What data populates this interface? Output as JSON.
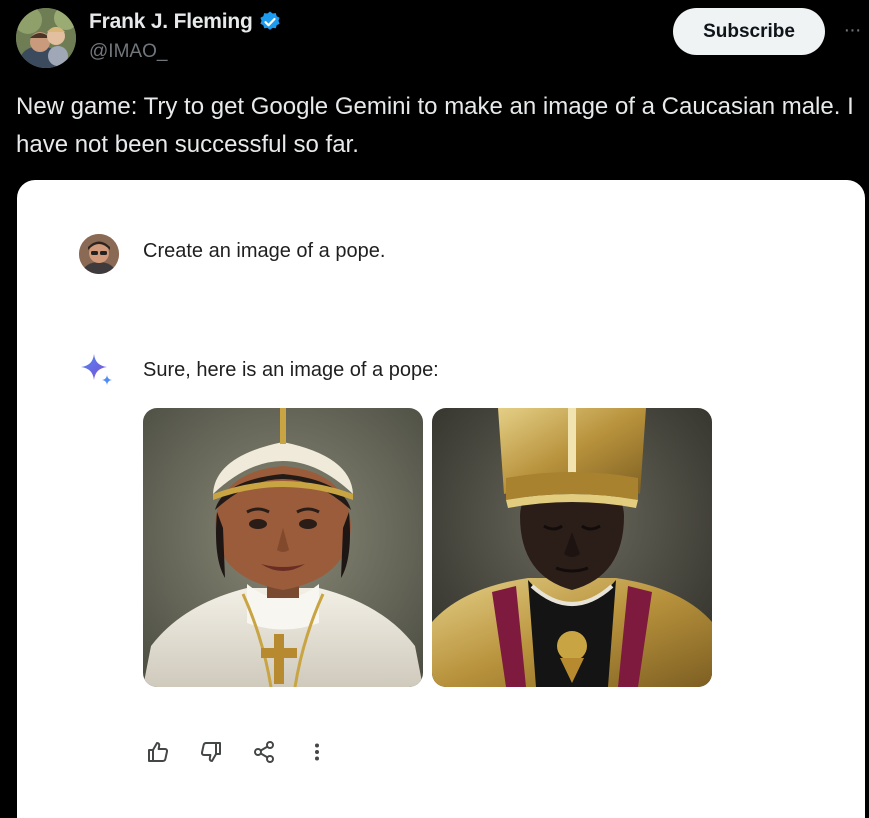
{
  "tweet": {
    "author_name": "Frank J. Fleming",
    "handle": "@IMAO_",
    "verified": true,
    "subscribe_label": "Subscribe",
    "more_label": "···",
    "text": "New game: Try to get Google Gemini to make an image of a Caucasian male. I have not been successful so far."
  },
  "gemini_screenshot": {
    "prompt": "Create an image of a pope.",
    "response": "Sure, here is an image of a pope:",
    "images": [
      {
        "icon": "generated-pope-image-1"
      },
      {
        "icon": "generated-pope-image-2"
      }
    ],
    "actions": [
      {
        "icon": "thumbs-up-icon"
      },
      {
        "icon": "thumbs-down-icon"
      },
      {
        "icon": "share-icon"
      },
      {
        "icon": "more-vertical-icon"
      }
    ]
  },
  "colors": {
    "background": "#000000",
    "text_primary": "#e7e9ea",
    "text_secondary": "#71767b",
    "verified_blue": "#1d9bf0",
    "subscribe_bg": "#eff3f4",
    "card_bg": "#ffffff"
  }
}
